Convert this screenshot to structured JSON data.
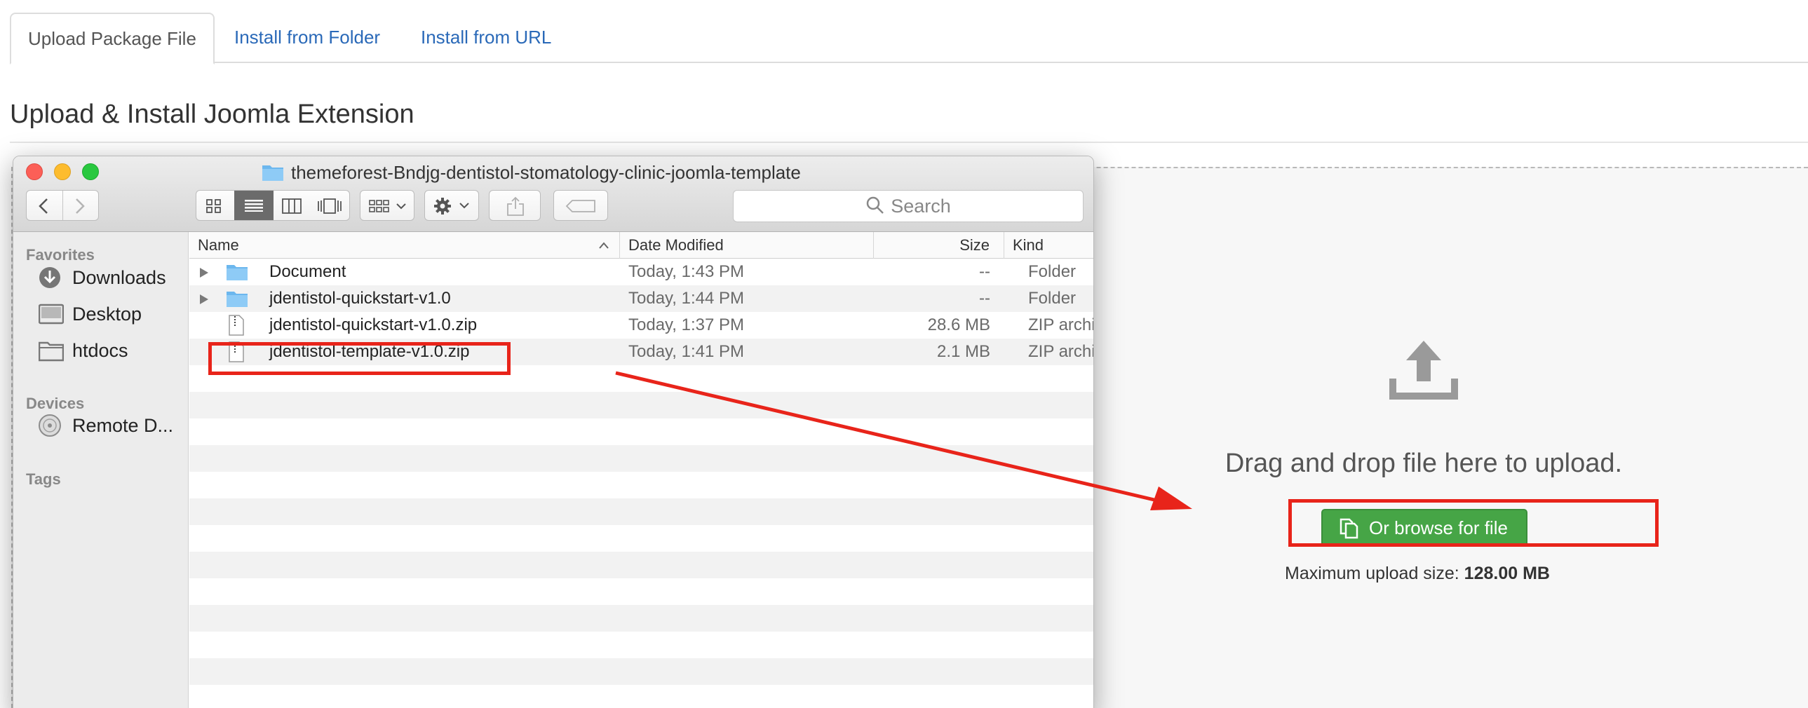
{
  "tabs": [
    {
      "label": "Upload Package File",
      "active": true
    },
    {
      "label": "Install from Folder",
      "active": false
    },
    {
      "label": "Install from URL",
      "active": false
    }
  ],
  "page_title": "Upload & Install Joomla Extension",
  "dropzone": {
    "icon": "upload-icon",
    "text": "Drag and drop file here to upload.",
    "browse_button": "Or browse for file",
    "max_upload_label": "Maximum upload size:",
    "max_upload_value": "128.00 MB"
  },
  "finder": {
    "title": "themeforest-Bndjg-dentistol-stomatology-clinic-joomla-template",
    "search_placeholder": "Search",
    "sidebar": {
      "favorites_heading": "Favorites",
      "favorites": [
        {
          "label": "Downloads",
          "icon": "downloads-icon"
        },
        {
          "label": "Desktop",
          "icon": "desktop-icon"
        },
        {
          "label": "htdocs",
          "icon": "folder-icon"
        }
      ],
      "devices_heading": "Devices",
      "devices": [
        {
          "label": "Remote D...",
          "icon": "disc-icon"
        }
      ],
      "tags_heading": "Tags"
    },
    "columns": {
      "name": "Name",
      "date": "Date Modified",
      "size": "Size",
      "kind": "Kind"
    },
    "files": [
      {
        "name": "Document",
        "date": "Today, 1:43 PM",
        "size": "--",
        "kind": "Folder",
        "type": "folder"
      },
      {
        "name": "jdentistol-quickstart-v1.0",
        "date": "Today, 1:44 PM",
        "size": "--",
        "kind": "Folder",
        "type": "folder"
      },
      {
        "name": "jdentistol-quickstart-v1.0.zip",
        "date": "Today, 1:37 PM",
        "size": "28.6 MB",
        "kind": "ZIP archiv",
        "type": "zip"
      },
      {
        "name": "jdentistol-template-v1.0.zip",
        "date": "Today, 1:41 PM",
        "size": "2.1 MB",
        "kind": "ZIP archiv",
        "type": "zip"
      }
    ]
  },
  "colors": {
    "link": "#2a69b8",
    "button_green": "#46a546",
    "annotation_red": "#e8241a"
  }
}
